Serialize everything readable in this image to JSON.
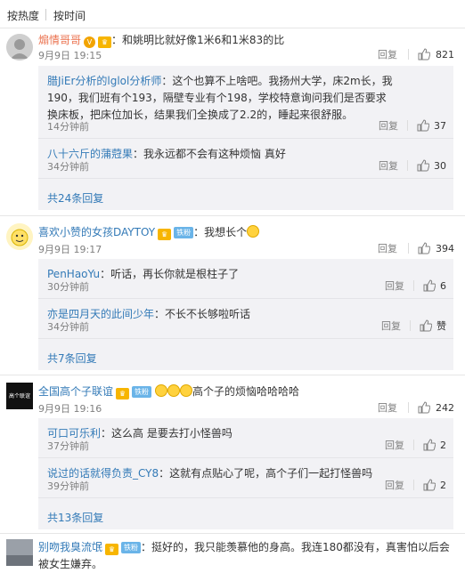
{
  "sort": {
    "hot": "按热度",
    "time": "按时间"
  },
  "comments": [
    {
      "user": "煽情哥哥",
      "text": "：和姚明比就好像1米6和1米83的比",
      "time": "9月9日 19:15",
      "reply_label": "回复",
      "likes": "821",
      "replies": [
        {
          "user": "腊JiEr分析的lglol分析师",
          "text": "：这个也算不上啥吧。我扬州大学，床2m长，我190，我们班有个193，隔壁专业有个198，学校特意询问我们是否要求换床板，把床位加长，结果我们全换成了2.2的，睡起来很舒服。",
          "time": "14分钟前",
          "reply_label": "回复",
          "likes": "37"
        },
        {
          "user": "八十六斤的蒲蒄果",
          "text": "：我永远都不会有这种烦恼 真好",
          "time": "34分钟前",
          "reply_label": "回复",
          "likes": "30"
        }
      ],
      "more": "共24条回复"
    },
    {
      "user": "喜欢小赞的女孩DAYTOY",
      "fan_label": "铁粉",
      "text": "：我想长个",
      "time": "9月9日 19:17",
      "reply_label": "回复",
      "likes": "394",
      "replies": [
        {
          "user": "PenHaoYu",
          "text": "：听话，再长你就是根柱子了",
          "time": "30分钟前",
          "reply_label": "回复",
          "likes": "6"
        },
        {
          "user": "亦是四月天的此间少年",
          "text": "：不长不长够啦听话",
          "time": "34分钟前",
          "reply_label": "回复",
          "likes": "赞"
        }
      ],
      "more": "共7条回复"
    },
    {
      "user": "全国高个子联谊",
      "fan_label": "铁粉",
      "text": "高个子的烦恼哈哈哈哈",
      "time": "9月9日 19:16",
      "reply_label": "回复",
      "likes": "242",
      "avatar_text": "高个联谊",
      "replies": [
        {
          "user": "可口可乐利",
          "text": "：这么高 是要去打小怪兽吗",
          "time": "37分钟前",
          "reply_label": "回复",
          "likes": "2"
        },
        {
          "user": "说过的话就得负责_CY8",
          "text": "：这就有点贴心了呢，高个子们一起打怪兽吗",
          "time": "39分钟前",
          "reply_label": "回复",
          "likes": "2"
        }
      ],
      "more": "共13条回复"
    },
    {
      "user": "别吻我臭流氓",
      "fan_label": "铁粉",
      "text": "：挺好的，我只能羡慕他的身高。我连180都没有，真害怕以后会被女生嫌弃。"
    }
  ],
  "colors": {
    "username": "#eb7350",
    "link": "#337ab7",
    "reply_bg": "#f2f2f5"
  },
  "icons": {
    "like": "thumb-up-icon",
    "badge": "crown-badge-icon"
  }
}
